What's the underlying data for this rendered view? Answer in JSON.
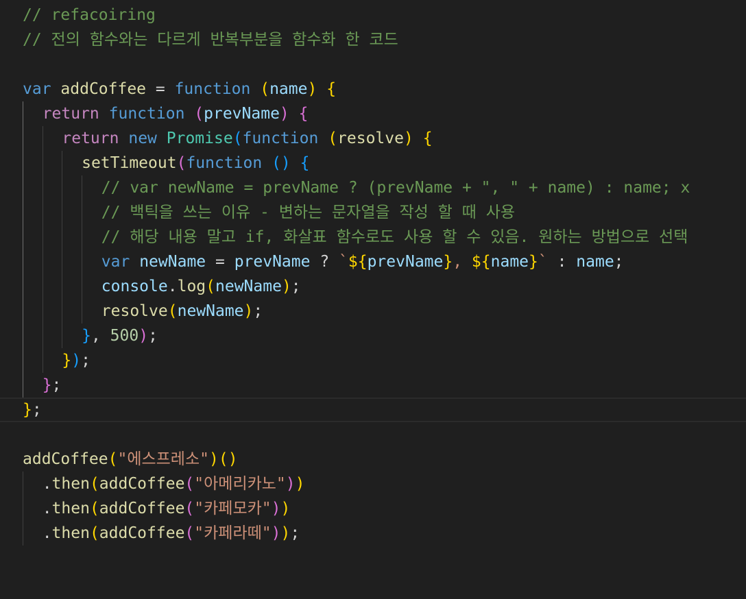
{
  "editor": {
    "language": "javascript",
    "theme_background": "#1f1f1f",
    "current_line": 17,
    "lines": [
      {
        "indent": 0,
        "tokens": [
          {
            "t": "// refacoiring",
            "c": "comment"
          }
        ]
      },
      {
        "indent": 0,
        "tokens": [
          {
            "t": "// 전의 함수와는 다르게 반복부분을 함수화 한 코드",
            "c": "comment"
          }
        ]
      },
      {
        "indent": 0,
        "tokens": []
      },
      {
        "indent": 0,
        "tokens": [
          {
            "t": "var",
            "c": "kw"
          },
          {
            "t": " ",
            "c": "punc"
          },
          {
            "t": "addCoffee",
            "c": "fn"
          },
          {
            "t": " = ",
            "c": "op"
          },
          {
            "t": "function",
            "c": "kw"
          },
          {
            "t": " ",
            "c": "punc"
          },
          {
            "t": "(",
            "c": "b1"
          },
          {
            "t": "name",
            "c": "param"
          },
          {
            "t": ")",
            "c": "b1"
          },
          {
            "t": " ",
            "c": "punc"
          },
          {
            "t": "{",
            "c": "b1"
          }
        ]
      },
      {
        "indent": 1,
        "tokens": [
          {
            "t": "return",
            "c": "ctrl"
          },
          {
            "t": " ",
            "c": "punc"
          },
          {
            "t": "function",
            "c": "kw"
          },
          {
            "t": " ",
            "c": "punc"
          },
          {
            "t": "(",
            "c": "b2"
          },
          {
            "t": "prevName",
            "c": "param"
          },
          {
            "t": ")",
            "c": "b2"
          },
          {
            "t": " ",
            "c": "punc"
          },
          {
            "t": "{",
            "c": "b2"
          }
        ]
      },
      {
        "indent": 2,
        "tokens": [
          {
            "t": "return",
            "c": "ctrl"
          },
          {
            "t": " ",
            "c": "punc"
          },
          {
            "t": "new",
            "c": "kw"
          },
          {
            "t": " ",
            "c": "punc"
          },
          {
            "t": "Promise",
            "c": "class"
          },
          {
            "t": "(",
            "c": "b3"
          },
          {
            "t": "function",
            "c": "kw"
          },
          {
            "t": " ",
            "c": "punc"
          },
          {
            "t": "(",
            "c": "b1"
          },
          {
            "t": "resolve",
            "c": "fn"
          },
          {
            "t": ")",
            "c": "b1"
          },
          {
            "t": " ",
            "c": "punc"
          },
          {
            "t": "{",
            "c": "b1"
          }
        ]
      },
      {
        "indent": 3,
        "tokens": [
          {
            "t": "setTimeout",
            "c": "fn"
          },
          {
            "t": "(",
            "c": "b2"
          },
          {
            "t": "function",
            "c": "kw"
          },
          {
            "t": " ",
            "c": "punc"
          },
          {
            "t": "()",
            "c": "b3"
          },
          {
            "t": " ",
            "c": "punc"
          },
          {
            "t": "{",
            "c": "b3"
          }
        ]
      },
      {
        "indent": 4,
        "tokens": [
          {
            "t": "// var newName = prevName ? (prevName + \", \" + name) : name; x",
            "c": "comment"
          }
        ]
      },
      {
        "indent": 4,
        "tokens": [
          {
            "t": "// 백틱을 쓰는 이유 - 변하는 문자열을 작성 할 때 사용",
            "c": "comment"
          }
        ]
      },
      {
        "indent": 4,
        "tokens": [
          {
            "t": "// 해당 내용 말고 if, 화살표 함수로도 사용 할 수 있음. 원하는 방법으로 선택",
            "c": "comment"
          }
        ]
      },
      {
        "indent": 4,
        "tokens": [
          {
            "t": "var",
            "c": "kw"
          },
          {
            "t": " ",
            "c": "punc"
          },
          {
            "t": "newName",
            "c": "var"
          },
          {
            "t": " = ",
            "c": "op"
          },
          {
            "t": "prevName",
            "c": "var"
          },
          {
            "t": " ? ",
            "c": "op"
          },
          {
            "t": "`",
            "c": "tpl"
          },
          {
            "t": "${",
            "c": "b1"
          },
          {
            "t": "prevName",
            "c": "var"
          },
          {
            "t": "}",
            "c": "b1"
          },
          {
            "t": ", ",
            "c": "tpl"
          },
          {
            "t": "${",
            "c": "b1"
          },
          {
            "t": "name",
            "c": "var"
          },
          {
            "t": "}",
            "c": "b1"
          },
          {
            "t": "`",
            "c": "tpl"
          },
          {
            "t": " : ",
            "c": "op"
          },
          {
            "t": "name",
            "c": "var"
          },
          {
            "t": ";",
            "c": "punc"
          }
        ]
      },
      {
        "indent": 4,
        "tokens": [
          {
            "t": "console",
            "c": "var"
          },
          {
            "t": ".",
            "c": "punc"
          },
          {
            "t": "log",
            "c": "fn"
          },
          {
            "t": "(",
            "c": "b1"
          },
          {
            "t": "newName",
            "c": "var"
          },
          {
            "t": ")",
            "c": "b1"
          },
          {
            "t": ";",
            "c": "punc"
          }
        ]
      },
      {
        "indent": 4,
        "tokens": [
          {
            "t": "resolve",
            "c": "fn"
          },
          {
            "t": "(",
            "c": "b1"
          },
          {
            "t": "newName",
            "c": "var"
          },
          {
            "t": ")",
            "c": "b1"
          },
          {
            "t": ";",
            "c": "punc"
          }
        ]
      },
      {
        "indent": 3,
        "tokens": [
          {
            "t": "}",
            "c": "b3"
          },
          {
            "t": ", ",
            "c": "punc"
          },
          {
            "t": "500",
            "c": "num"
          },
          {
            "t": ")",
            "c": "b2"
          },
          {
            "t": ";",
            "c": "punc"
          }
        ]
      },
      {
        "indent": 2,
        "tokens": [
          {
            "t": "}",
            "c": "b1"
          },
          {
            "t": ")",
            "c": "b3"
          },
          {
            "t": ";",
            "c": "punc"
          }
        ]
      },
      {
        "indent": 1,
        "tokens": [
          {
            "t": "}",
            "c": "b2"
          },
          {
            "t": ";",
            "c": "punc"
          }
        ]
      },
      {
        "indent": 0,
        "tokens": [
          {
            "t": "}",
            "c": "b1"
          },
          {
            "t": ";",
            "c": "punc"
          }
        ]
      },
      {
        "indent": 0,
        "tokens": []
      },
      {
        "indent": 0,
        "tokens": [
          {
            "t": "addCoffee",
            "c": "fn"
          },
          {
            "t": "(",
            "c": "b1"
          },
          {
            "t": "\"에스프레소\"",
            "c": "str"
          },
          {
            "t": ")",
            "c": "b1"
          },
          {
            "t": "()",
            "c": "b1"
          }
        ]
      },
      {
        "indent": 1,
        "tokens": [
          {
            "t": ".",
            "c": "punc"
          },
          {
            "t": "then",
            "c": "fn"
          },
          {
            "t": "(",
            "c": "b1"
          },
          {
            "t": "addCoffee",
            "c": "fn"
          },
          {
            "t": "(",
            "c": "b2"
          },
          {
            "t": "\"아메리카노\"",
            "c": "str"
          },
          {
            "t": ")",
            "c": "b2"
          },
          {
            "t": ")",
            "c": "b1"
          }
        ]
      },
      {
        "indent": 1,
        "tokens": [
          {
            "t": ".",
            "c": "punc"
          },
          {
            "t": "then",
            "c": "fn"
          },
          {
            "t": "(",
            "c": "b1"
          },
          {
            "t": "addCoffee",
            "c": "fn"
          },
          {
            "t": "(",
            "c": "b2"
          },
          {
            "t": "\"카페모카\"",
            "c": "str"
          },
          {
            "t": ")",
            "c": "b2"
          },
          {
            "t": ")",
            "c": "b1"
          }
        ]
      },
      {
        "indent": 1,
        "tokens": [
          {
            "t": ".",
            "c": "punc"
          },
          {
            "t": "then",
            "c": "fn"
          },
          {
            "t": "(",
            "c": "b1"
          },
          {
            "t": "addCoffee",
            "c": "fn"
          },
          {
            "t": "(",
            "c": "b2"
          },
          {
            "t": "\"카페라떼\"",
            "c": "str"
          },
          {
            "t": ")",
            "c": "b2"
          },
          {
            "t": ")",
            "c": "b1"
          },
          {
            "t": ";",
            "c": "punc"
          }
        ]
      }
    ]
  }
}
